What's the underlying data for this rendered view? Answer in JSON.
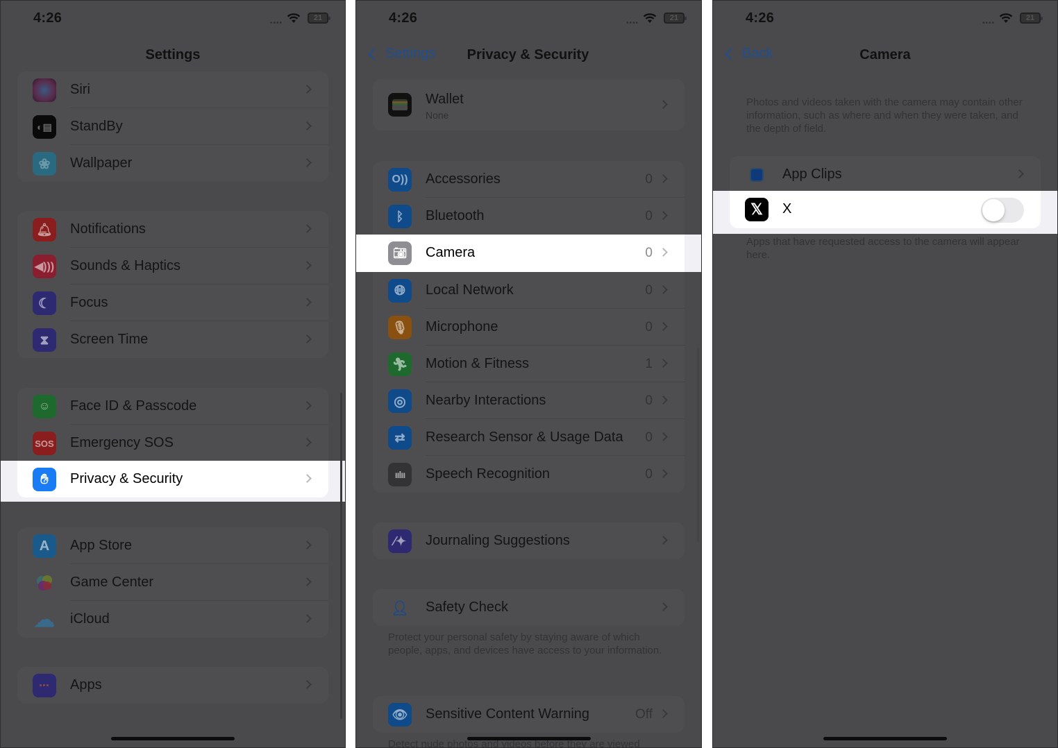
{
  "status_bar": {
    "time": "4:26",
    "battery": "21"
  },
  "screen1": {
    "title": "Settings",
    "groups": [
      [
        {
          "label": "Siri",
          "icon": "siri-icon"
        },
        {
          "label": "StandBy",
          "icon": "standby-icon"
        },
        {
          "label": "Wallpaper",
          "icon": "wallpaper-icon"
        }
      ],
      [
        {
          "label": "Notifications",
          "icon": "notifications-icon"
        },
        {
          "label": "Sounds & Haptics",
          "icon": "sounds-icon"
        },
        {
          "label": "Focus",
          "icon": "focus-moon-icon"
        },
        {
          "label": "Screen Time",
          "icon": "hourglass-icon"
        }
      ],
      [
        {
          "label": "Face ID & Passcode",
          "icon": "faceid-icon"
        },
        {
          "label": "Emergency SOS",
          "icon": "sos-icon",
          "glyph": "SOS"
        },
        {
          "label": "Privacy & Security",
          "icon": "hand-icon",
          "highlighted": true
        }
      ],
      [
        {
          "label": "App Store",
          "icon": "app-store-icon"
        },
        {
          "label": "Game Center",
          "icon": "game-center-icon"
        },
        {
          "label": "iCloud",
          "icon": "icloud-icon"
        }
      ],
      [
        {
          "label": "Apps",
          "icon": "apps-grid-icon"
        }
      ]
    ]
  },
  "screen2": {
    "back_label": "Settings",
    "title": "Privacy & Security",
    "wallet": {
      "label": "Wallet",
      "sublabel": "None"
    },
    "permissions": [
      {
        "label": "Accessories",
        "value": "0"
      },
      {
        "label": "Bluetooth",
        "value": "0"
      },
      {
        "label": "Camera",
        "value": "0",
        "highlighted": true
      },
      {
        "label": "Local Network",
        "value": "0"
      },
      {
        "label": "Microphone",
        "value": "0"
      },
      {
        "label": "Motion & Fitness",
        "value": "1"
      },
      {
        "label": "Nearby Interactions",
        "value": "0"
      },
      {
        "label": "Research Sensor & Usage Data",
        "value": "0"
      },
      {
        "label": "Speech Recognition",
        "value": "0"
      }
    ],
    "journaling": {
      "label": "Journaling Suggestions"
    },
    "safety_check": {
      "label": "Safety Check",
      "footer": "Protect your personal safety by staying aware of which people, apps, and devices have access to your information."
    },
    "sensitive": {
      "label": "Sensitive Content Warning",
      "value": "Off",
      "footer": "Detect nude photos and videos before they are viewed"
    }
  },
  "screen3": {
    "back_label": "Back",
    "title": "Camera",
    "header_text": "Photos and videos taken with the camera may contain other information, such as where and when they were taken, and the depth of field.",
    "app_clips": {
      "label": "App Clips"
    },
    "app": {
      "label": "X",
      "toggle_on": false
    },
    "footer_text": "Apps that have requested access to the camera will appear here."
  }
}
